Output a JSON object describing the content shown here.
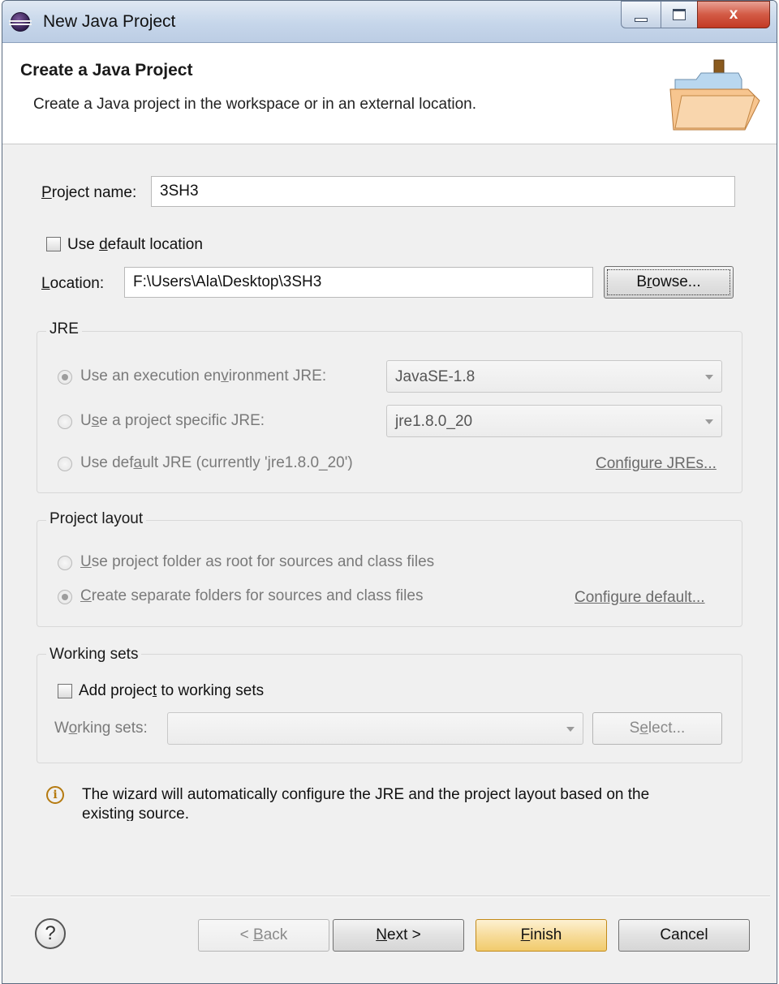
{
  "window": {
    "title": "New Java Project",
    "close_glyph": "x"
  },
  "header": {
    "title": "Create a Java Project",
    "description": "Create a Java project in the workspace or in an external location.",
    "icon": "java-project-folder-icon"
  },
  "project_name": {
    "label_first": "P",
    "label_rest": "roject name:",
    "value": "3SH3"
  },
  "use_default_location": {
    "label_pre": "Use ",
    "label_u": "d",
    "label_post": "efault location",
    "checked": false
  },
  "location": {
    "label_first": "L",
    "label_rest": "ocation:",
    "value": "F:\\Users\\Ala\\Desktop\\3SH3",
    "browse_pre": "B",
    "browse_u": "r",
    "browse_post": "owse..."
  },
  "jre": {
    "title": "JRE",
    "option1": {
      "pre": "Use an execution en",
      "u": "v",
      "post": "ironment JRE:",
      "selected": true,
      "combo": "JavaSE-1.8"
    },
    "option2": {
      "pre": "U",
      "u": "s",
      "post": "e a project specific JRE:",
      "selected": false,
      "combo": "jre1.8.0_20"
    },
    "option3": {
      "pre": "Use def",
      "u": "a",
      "post": "ult JRE (currently 'jre1.8.0_20')",
      "selected": false
    },
    "configure_link": "Configure JREs..."
  },
  "project_layout": {
    "title": "Project layout",
    "option1": {
      "u": "U",
      "post": "se project folder as root for sources and class files",
      "selected": false
    },
    "option2": {
      "u": "C",
      "post": "reate separate folders for sources and class files",
      "selected": true
    },
    "configure_link": "Configure default..."
  },
  "working_sets": {
    "title": "Working sets",
    "add_pre": "Add projec",
    "add_u": "t",
    "add_post": " to working sets",
    "checked": false,
    "label_pre": "W",
    "label_u": "o",
    "label_post": "rking sets:",
    "select_pre": "S",
    "select_u": "e",
    "select_post": "lect..."
  },
  "info": {
    "line1": "The wizard will automatically configure the JRE and the project layout based on the",
    "line2": "existing source."
  },
  "buttons": {
    "back_pre": "< ",
    "back_u": "B",
    "back_post": "ack",
    "next_u": "N",
    "next_post": "ext >",
    "finish_u": "F",
    "finish_post": "inish",
    "cancel": "Cancel"
  },
  "colors": {
    "default_button": "#f7dc9b",
    "title_bar": "#c6d6ea",
    "close_button": "#d35a45"
  }
}
